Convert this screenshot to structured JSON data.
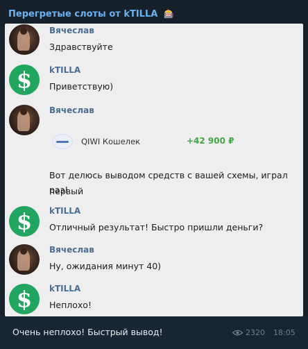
{
  "header": {
    "title": "Перегретые слоты от kTILLA",
    "emoji_icon": "slot-machine-icon"
  },
  "messages": [
    {
      "author": "Вячеслав",
      "avatar": "photo",
      "text": "Здравствуйте"
    },
    {
      "author": "kTILLA",
      "avatar": "dollar-icon",
      "text": "Приветствую)"
    },
    {
      "author": "Вячеслав",
      "avatar": "photo",
      "attachment": {
        "name": "QIWI Кошелек",
        "amount": "+42 900 ₽"
      },
      "text_line1": "Вот делюсь выводом средств с вашей схемы, играл первый",
      "text_line2": "раз!"
    },
    {
      "author": "kTILLA",
      "avatar": "dollar-icon",
      "text": "Отличный результат! Быстро пришли деньги?"
    },
    {
      "author": "Вячеслав",
      "avatar": "photo",
      "text": "Ну, ожидания минут 40)"
    },
    {
      "author": "kTILLA",
      "avatar": "dollar-icon",
      "text": "Неплохо!"
    }
  ],
  "footer": {
    "caption": "Очень неплохо! Быстрый вывод!",
    "views": "2320",
    "time": "18:05"
  },
  "colors": {
    "header_title": "#6ab2f2",
    "author_name": "#4a6e93",
    "amount_green": "#43a745",
    "dollar_green": "#22a65f",
    "background": "#17212b"
  }
}
